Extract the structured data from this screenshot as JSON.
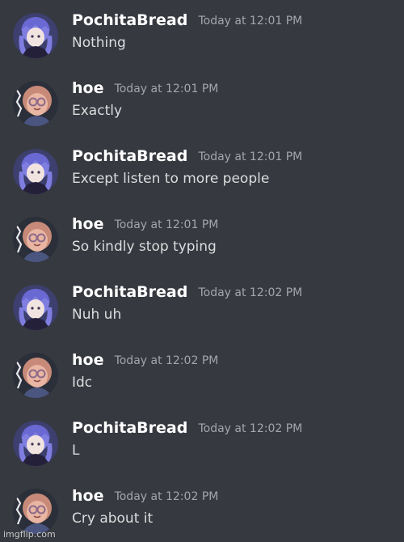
{
  "messages": [
    {
      "author": "PochitaBread",
      "timestamp": "Today at 12:01 PM",
      "text": "Nothing",
      "avatar": "pochita-avatar"
    },
    {
      "author": "hoe",
      "timestamp": "Today at 12:01 PM",
      "text": "Exactly",
      "avatar": "hoe-avatar"
    },
    {
      "author": "PochitaBread",
      "timestamp": "Today at 12:01 PM",
      "text": "Except listen to more people",
      "avatar": "pochita-avatar"
    },
    {
      "author": "hoe",
      "timestamp": "Today at 12:01 PM",
      "text": "So kindly stop typing",
      "avatar": "hoe-avatar"
    },
    {
      "author": "PochitaBread",
      "timestamp": "Today at 12:02 PM",
      "text": "Nuh uh",
      "avatar": "pochita-avatar"
    },
    {
      "author": "hoe",
      "timestamp": "Today at 12:02 PM",
      "text": "Idc",
      "avatar": "hoe-avatar"
    },
    {
      "author": "PochitaBread",
      "timestamp": "Today at 12:02 PM",
      "text": "L",
      "avatar": "pochita-avatar"
    },
    {
      "author": "hoe",
      "timestamp": "Today at 12:02 PM",
      "text": "Cry about it",
      "avatar": "hoe-avatar"
    }
  ],
  "watermark": "imgflip.com",
  "colors": {
    "background": "#36393f",
    "author": "#ffffff",
    "timestamp": "#a3a6aa",
    "message_text": "#dcddde"
  }
}
